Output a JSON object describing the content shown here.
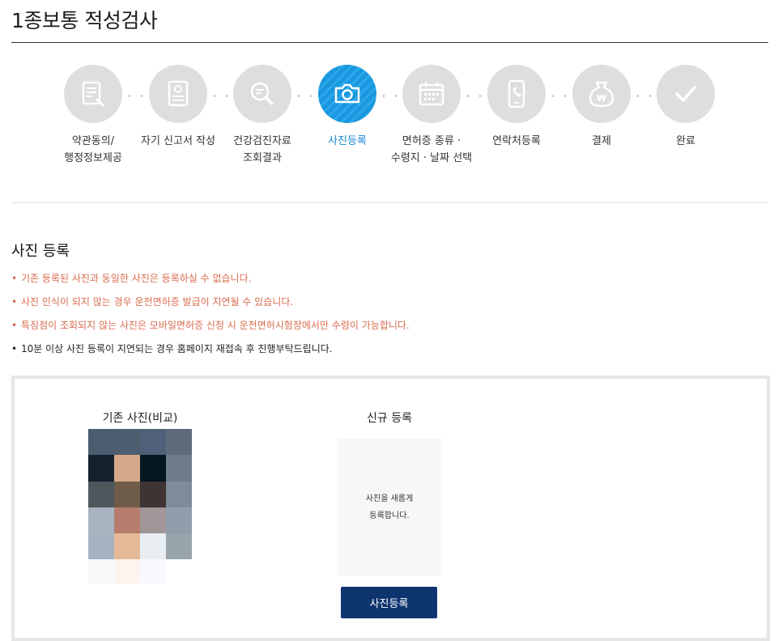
{
  "page": {
    "title": "1종보통 적성검사"
  },
  "steps": [
    {
      "label": "약관동의/\n행정정보제공",
      "icon": "document-pen-icon",
      "active": false
    },
    {
      "label": "자기 신고서 작성",
      "icon": "id-card-icon",
      "active": false
    },
    {
      "label": "건강검진자료\n조회결과",
      "icon": "magnifier-icon",
      "active": false
    },
    {
      "label": "사진등록",
      "icon": "camera-icon",
      "active": true
    },
    {
      "label": "면허증 종류 ·\n수령지 · 날짜 선택",
      "icon": "calendar-icon",
      "active": false
    },
    {
      "label": "연락처등록",
      "icon": "phone-icon",
      "active": false
    },
    {
      "label": "결제",
      "icon": "won-bag-icon",
      "active": false
    },
    {
      "label": "완료",
      "icon": "check-icon",
      "active": false
    }
  ],
  "section": {
    "title": "사진 등록",
    "notices": [
      {
        "text": "기존 등록된 사진과 동일한 사진은 등록하실 수 없습니다.",
        "color": "#d96b4e"
      },
      {
        "text": "사진 인식이 되지 않는 경우 운전면허증 발급이 지연될 수 있습니다.",
        "color": "#d96b4e"
      },
      {
        "text": "특징점이 조회되지 않는 사진은 모바일면허증 신청 시 운전면허시험장에서만 수령이 가능합니다.",
        "color": "#d96b4e"
      },
      {
        "text": "10분 이상 사진 등록이 지연되는 경우 홈페이지 재접속 후 진행부탁드립니다.",
        "color": "#222222"
      }
    ]
  },
  "photo": {
    "old_title": "기존 사진(비교)",
    "new_title": "신규 등록",
    "new_placeholder": "사진을 새롭게\n등록합니다.",
    "register_button": "사진등록",
    "pixel_colors": [
      "#4a5c6e",
      "#4d5e70",
      "#4f6078",
      "#5c6a7c",
      "#14222e",
      "#d6a88a",
      "#06161e",
      "#6e7c8e",
      "#4e585c",
      "#6e5c48",
      "#3e3434",
      "#7e8c9a",
      "#a8b4c0",
      "#b67c6c",
      "#a09698",
      "#909eac",
      "#a6b2c2",
      "#e6ba98",
      "#e8eef2",
      "#98a4ac"
    ],
    "fade_colors": [
      "#f8f9fb",
      "#fcf4ef",
      "#f7f9fc",
      "#ffffff"
    ]
  },
  "colors": {
    "accent": "#1a97de",
    "button": "#0f3570",
    "warning": "#d96b4e"
  }
}
